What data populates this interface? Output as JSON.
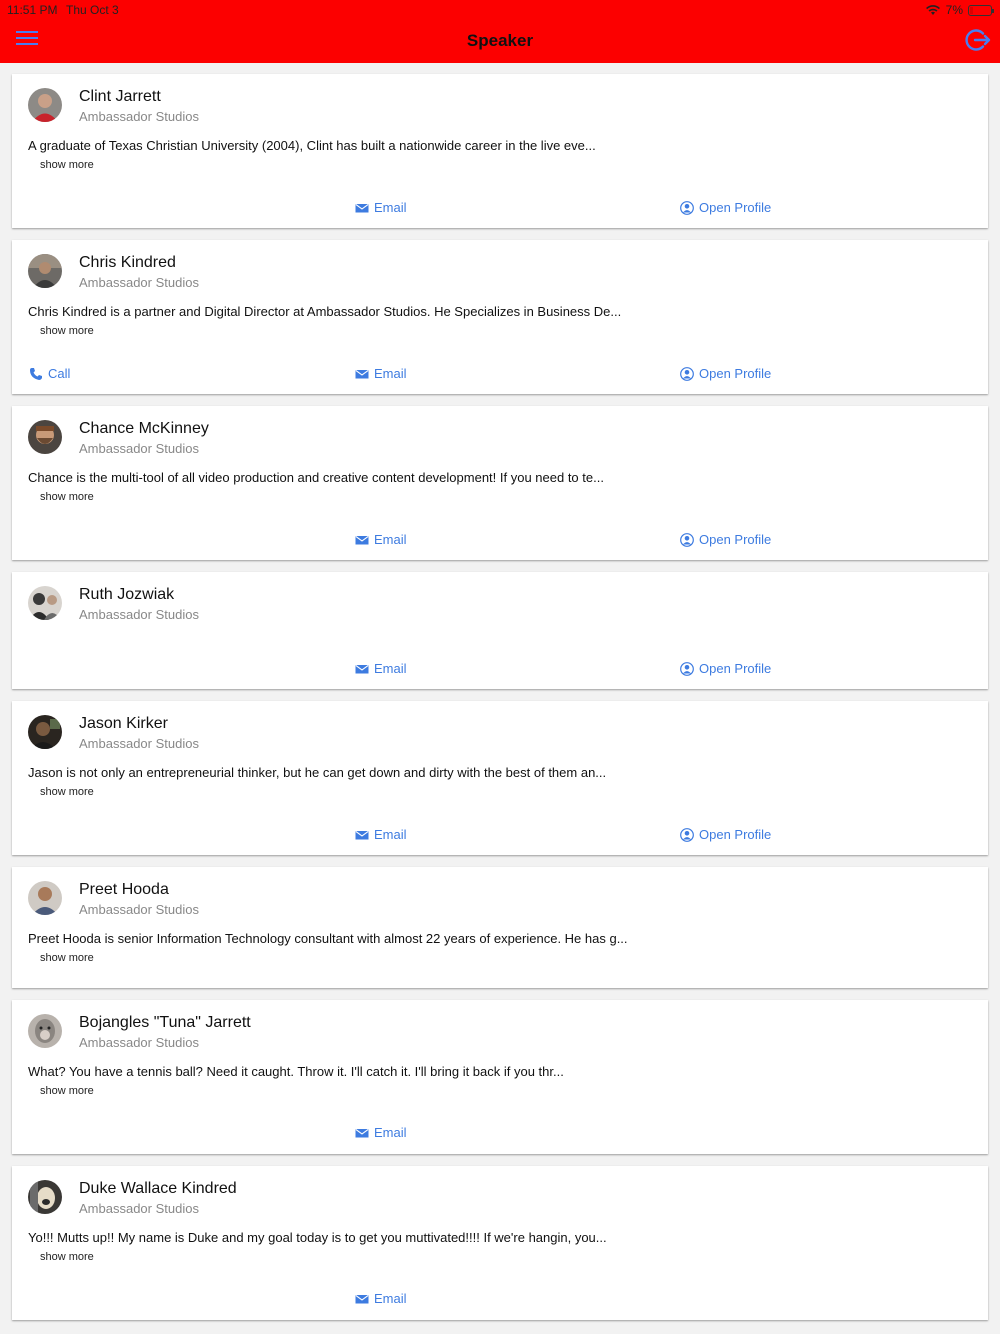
{
  "status_bar": {
    "time": "11:51 PM",
    "date": "Thu Oct 3",
    "battery": "7%"
  },
  "header": {
    "title": "Speaker",
    "menu_icon": "hamburger-menu-icon",
    "logout_icon": "logout-icon",
    "accent_color": "#fc0000",
    "icon_color": "#4a7df0"
  },
  "speakers": [
    {
      "name": "Clint Jarrett",
      "company": "Ambassador Studios",
      "bio": "A graduate of Texas Christian University (2004), Clint has built a nationwide career in the live eve...",
      "show_more": "show more",
      "email_label": "Email",
      "profile_label": "Open Profile"
    },
    {
      "name": "Chris Kindred",
      "company": "Ambassador Studios",
      "bio": "Chris Kindred is a partner and Digital Director at Ambassador Studios. He Specializes in Business De...",
      "show_more": "show more",
      "call_label": "Call",
      "email_label": "Email",
      "profile_label": "Open Profile"
    },
    {
      "name": "Chance McKinney",
      "company": "Ambassador Studios",
      "bio": "Chance is the multi-tool of all video production and creative content development! If you need to te...",
      "show_more": "show more",
      "email_label": "Email",
      "profile_label": "Open Profile"
    },
    {
      "name": "Ruth Jozwiak",
      "company": "Ambassador Studios",
      "email_label": "Email",
      "profile_label": "Open Profile"
    },
    {
      "name": "Jason Kirker",
      "company": "Ambassador Studios",
      "bio": "Jason is not only an entrepreneurial thinker, but he can get down and dirty with the best of them an...",
      "show_more": "show more",
      "email_label": "Email",
      "profile_label": "Open Profile"
    },
    {
      "name": "Preet Hooda",
      "company": "Ambassador Studios",
      "bio": "Preet Hooda is senior Information Technology consultant with almost 22 years of experience. He has g...",
      "show_more": "show more"
    },
    {
      "name": "Bojangles \"Tuna\" Jarrett",
      "company": "Ambassador Studios",
      "bio": "What? You have a tennis ball? Need it caught. Throw it. I'll catch it. I'll bring it back if you thr...",
      "show_more": "show more",
      "email_label": "Email"
    },
    {
      "name": "Duke Wallace Kindred",
      "company": "Ambassador Studios",
      "bio": "Yo!!! Mutts up!! My name is Duke and my goal today is to get you muttivated!!!! If we're hangin, you...",
      "show_more": "show more",
      "email_label": "Email"
    }
  ]
}
